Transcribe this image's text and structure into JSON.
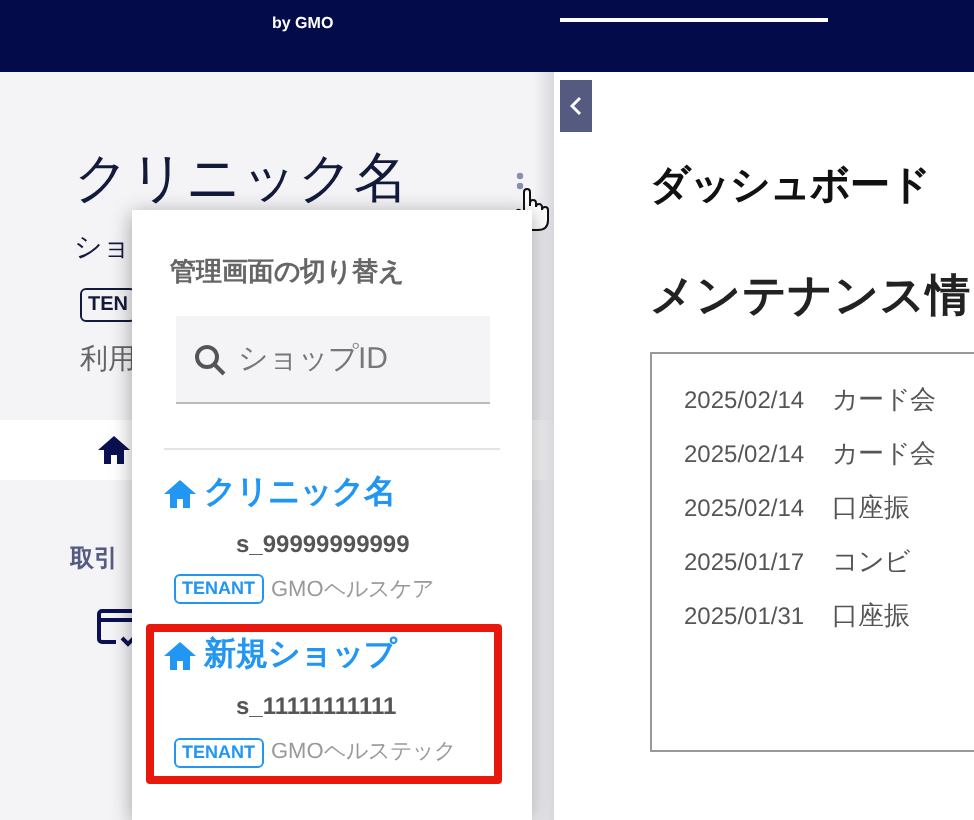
{
  "header": {
    "logo_sub": "by GMO"
  },
  "sidebar": {
    "shop_name": "クリニック名",
    "shop_label": "ショ",
    "tenant_badge": "TEN",
    "usage_label": "利用",
    "section_label": "取引"
  },
  "switcher": {
    "title": "管理画面の切り替え",
    "search": {
      "placeholder": "ショップID"
    },
    "shops": [
      {
        "name": "クリニック名",
        "id": "s_99999999999",
        "badge": "TENANT",
        "tenant": "GMOヘルスケア",
        "highlighted": false
      },
      {
        "name": "新規ショップ",
        "id": "s_11111111111",
        "badge": "TENANT",
        "tenant": "GMOヘルステック",
        "highlighted": true
      }
    ]
  },
  "main": {
    "title": "ダッシュボード",
    "section_title": "メンテナンス情",
    "maintenance": [
      {
        "date": "2025/02/14",
        "text": "カード会"
      },
      {
        "date": "2025/02/14",
        "text": "カード会"
      },
      {
        "date": "2025/02/14",
        "text": "口座振"
      },
      {
        "date": "2025/01/17",
        "text": "コンビ"
      },
      {
        "date": "2025/01/31",
        "text": "口座振"
      }
    ]
  }
}
